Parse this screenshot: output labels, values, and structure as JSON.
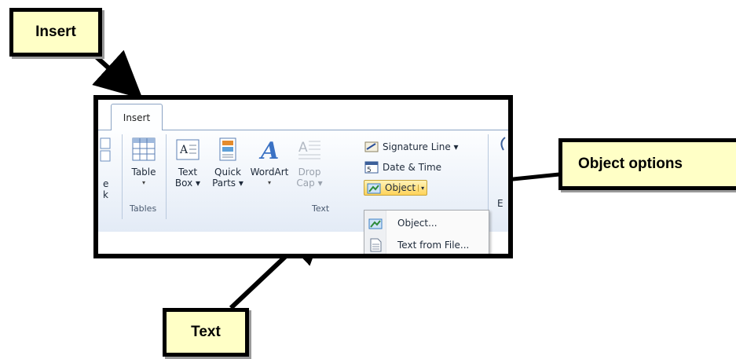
{
  "callouts": {
    "insert": "Insert",
    "object_options": "Object options",
    "text": "Text"
  },
  "ribbon": {
    "tab_label": "Insert",
    "partial_left_lines": [
      "e",
      "k"
    ],
    "groups": {
      "tables_label": "Tables",
      "text_label": "Text"
    },
    "buttons": {
      "table": {
        "line1": "Table",
        "line2": "▾"
      },
      "text_box": {
        "line1": "Text",
        "line2": "Box ▾"
      },
      "quick_parts": {
        "line1": "Quick",
        "line2": "Parts ▾"
      },
      "wordart": {
        "line1": "WordArt",
        "line2": "▾"
      },
      "drop_cap": {
        "line1": "Drop",
        "line2": "Cap ▾"
      }
    },
    "small_commands": {
      "signature_line": "Signature Line ▾",
      "date_time": "Date & Time",
      "object": "Object",
      "object_arrow": "▾"
    },
    "partial_right": "E"
  },
  "object_menu": {
    "items": [
      "Object...",
      "Text from File..."
    ]
  },
  "colors": {
    "callout_fill": "#ffffc6",
    "ribbon_border": "#8ba3c4",
    "object_highlight": "#ffd35a"
  }
}
